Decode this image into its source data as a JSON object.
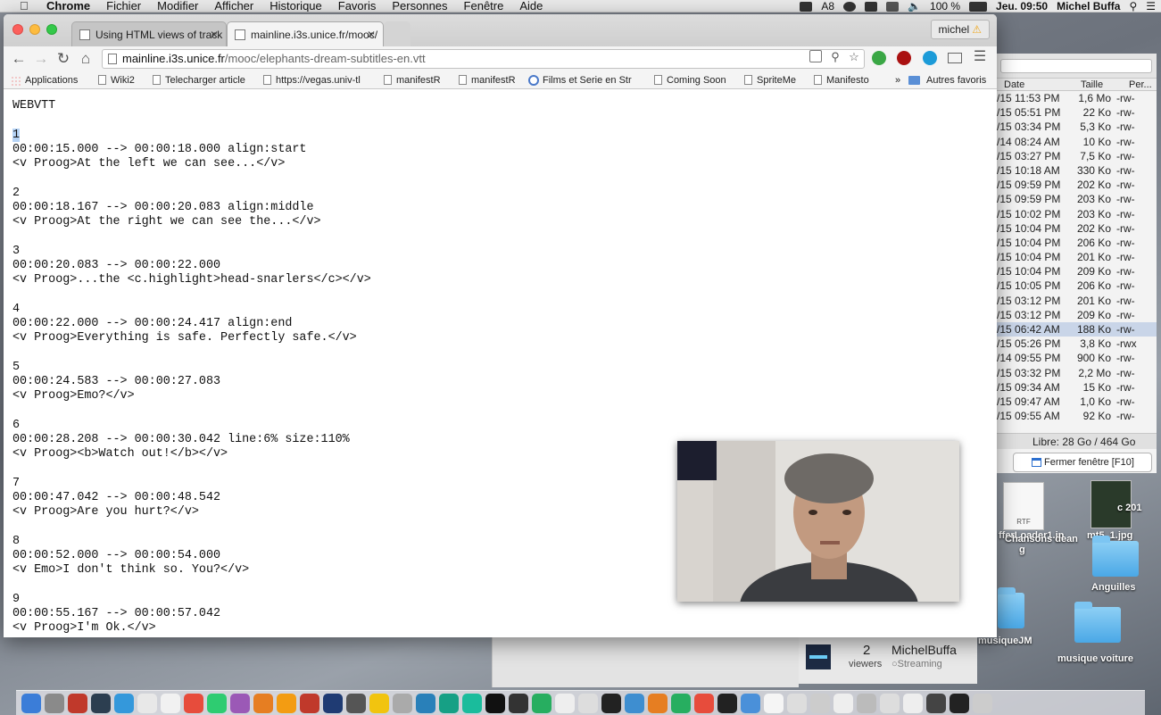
{
  "menubar": {
    "app_name": "Chrome",
    "items": [
      "Fichier",
      "Modifier",
      "Afficher",
      "Historique",
      "Favoris",
      "Personnes",
      "Fenêtre",
      "Aide"
    ],
    "status_badge": "8",
    "battery": "100 %",
    "clock": "Jeu. 09:50",
    "user": "Michel Buffa"
  },
  "browser": {
    "tabs": [
      {
        "title": "Using HTML views of track"
      },
      {
        "title": "mainline.i3s.unice.fr/mooc/"
      }
    ],
    "profile_name": "michel",
    "profile_warning": "⚠",
    "url_host": "mainline.i3s.unice.fr",
    "url_path": "/mooc/elephants-dream-subtitles-en.vtt",
    "bookmarks": [
      "Applications",
      "Wiki2",
      "Telecharger article",
      "https://vegas.univ-tl",
      "manifestR",
      "manifestR",
      "Films et Serie en Str",
      "Coming Soon",
      "SpriteMe",
      "Manifesto"
    ],
    "bookmarks_more": "»",
    "other_bookmarks": "Autres favoris"
  },
  "vtt": {
    "header": "WEBVTT",
    "cues": [
      {
        "id": "1",
        "timing": "00:00:15.000 --> 00:00:18.000 align:start",
        "text": "<v Proog>At the left we can see...</v>"
      },
      {
        "id": "2",
        "timing": "00:00:18.167 --> 00:00:20.083 align:middle",
        "text": "<v Proog>At the right we can see the...</v>"
      },
      {
        "id": "3",
        "timing": "00:00:20.083 --> 00:00:22.000",
        "text": "<v Proog>...the <c.highlight>head-snarlers</c></v>"
      },
      {
        "id": "4",
        "timing": "00:00:22.000 --> 00:00:24.417 align:end",
        "text": "<v Proog>Everything is safe. Perfectly safe.</v>"
      },
      {
        "id": "5",
        "timing": "00:00:24.583 --> 00:00:27.083",
        "text": "<v Proog>Emo?</v>"
      },
      {
        "id": "6",
        "timing": "00:00:28.208 --> 00:00:30.042 line:6% size:110%",
        "text": "<v Proog><b>Watch out!</b></v>"
      },
      {
        "id": "7",
        "timing": "00:00:47.042 --> 00:00:48.542",
        "text": "<v Proog>Are you hurt?</v>"
      },
      {
        "id": "8",
        "timing": "00:00:52.000 --> 00:00:54.000",
        "text": "<v Emo>I don't think so. You?</v>"
      },
      {
        "id": "9",
        "timing": "00:00:55.167 --> 00:00:57.042",
        "text": "<v Proog>I'm Ok.</v>"
      }
    ]
  },
  "finder": {
    "columns": [
      "Date",
      "Taille",
      "Per..."
    ],
    "rows": [
      {
        "date": "/15 11:53 PM",
        "size": "1,6 Mo",
        "perm": "-rw-"
      },
      {
        "date": "/15 05:51 PM",
        "size": "22 Ko",
        "perm": "-rw-"
      },
      {
        "date": "/15 03:34 PM",
        "size": "5,3 Ko",
        "perm": "-rw-"
      },
      {
        "date": "/14 08:24 AM",
        "size": "10 Ko",
        "perm": "-rw-"
      },
      {
        "date": "/15 03:27 PM",
        "size": "7,5 Ko",
        "perm": "-rw-"
      },
      {
        "date": "/15 10:18 AM",
        "size": "330 Ko",
        "perm": "-rw-"
      },
      {
        "date": "/15 09:59 PM",
        "size": "202 Ko",
        "perm": "-rw-"
      },
      {
        "date": "/15 09:59 PM",
        "size": "203 Ko",
        "perm": "-rw-"
      },
      {
        "date": "/15 10:02 PM",
        "size": "203 Ko",
        "perm": "-rw-"
      },
      {
        "date": "/15 10:04 PM",
        "size": "202 Ko",
        "perm": "-rw-"
      },
      {
        "date": "/15 10:04 PM",
        "size": "206 Ko",
        "perm": "-rw-"
      },
      {
        "date": "/15 10:04 PM",
        "size": "201 Ko",
        "perm": "-rw-"
      },
      {
        "date": "/15 10:04 PM",
        "size": "209 Ko",
        "perm": "-rw-"
      },
      {
        "date": "/15 10:05 PM",
        "size": "206 Ko",
        "perm": "-rw-"
      },
      {
        "date": "/15 03:12 PM",
        "size": "201 Ko",
        "perm": "-rw-"
      },
      {
        "date": "/15 03:12 PM",
        "size": "209 Ko",
        "perm": "-rw-"
      },
      {
        "date": "/15 06:42 AM",
        "size": "188 Ko",
        "perm": "-rw-"
      },
      {
        "date": "/15 05:26 PM",
        "size": "3,8 Ko",
        "perm": "-rwx"
      },
      {
        "date": "/14 09:55 PM",
        "size": "900 Ko",
        "perm": "-rw-"
      },
      {
        "date": "/15 03:32 PM",
        "size": "2,2 Mo",
        "perm": "-rw-"
      },
      {
        "date": "/15 09:34 AM",
        "size": "15 Ko",
        "perm": "-rw-"
      },
      {
        "date": "/15 09:47 AM",
        "size": "1,0 Ko",
        "perm": "-rw-"
      },
      {
        "date": "/15 09:55 AM",
        "size": "92 Ko",
        "perm": "-rw-"
      }
    ],
    "disk_free": "Libre: 28 Go / 464 Go",
    "close_window": "Fermer fenêtre [F10]"
  },
  "desktop": {
    "icons": [
      "fferLoader1.jp",
      "mt5_1.jpg",
      "Chansons dean",
      "g",
      "Anguilles",
      "musiqueJM",
      "musique voiture"
    ],
    "rtf_label": "RTF",
    "partial": "c 201"
  },
  "stream": {
    "viewers_count": "2",
    "viewers_label": "viewers",
    "channel": "MichelBuffa",
    "status": "Streaming"
  }
}
